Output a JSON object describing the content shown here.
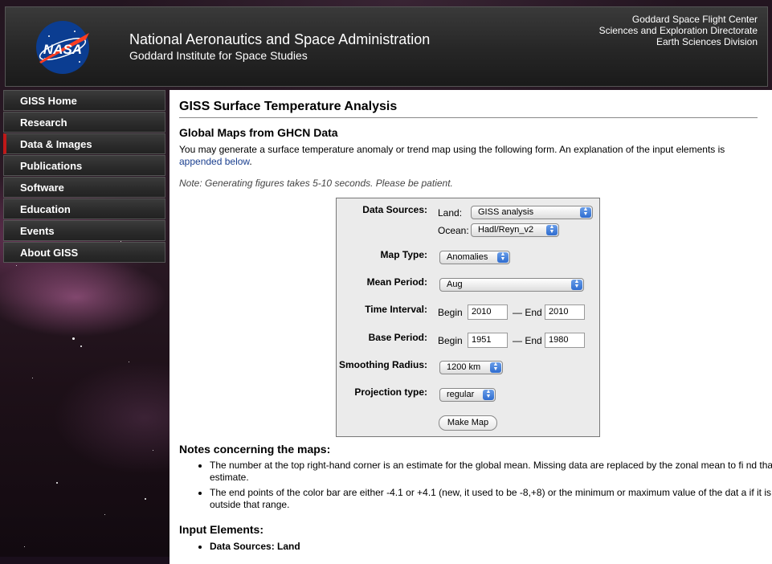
{
  "header": {
    "logo_text": "NASA",
    "title": "National Aeronautics and Space Administration",
    "subtitle": "Goddard Institute for Space Studies",
    "right_lines": [
      "Goddard Space Flight Center",
      "Sciences and Exploration Directorate",
      "Earth Sciences Division"
    ]
  },
  "nav": {
    "items": [
      {
        "label": "GISS Home"
      },
      {
        "label": "Research"
      },
      {
        "label": "Data & Images",
        "active": true
      },
      {
        "label": "Publications"
      },
      {
        "label": "Software"
      },
      {
        "label": "Education"
      },
      {
        "label": "Events"
      },
      {
        "label": "About GISS"
      }
    ]
  },
  "main": {
    "page_title": "GISS Surface Temperature Analysis",
    "section_title": "Global Maps from GHCN Data",
    "intro_text": "You may generate a surface temperature anomaly or trend map using the following form. An explanation of the input elements is",
    "intro_link": "appended below",
    "intro_end": ".",
    "note": "Note: Generating figures takes 5-10 seconds. Please be patient."
  },
  "form": {
    "data_sources_label": "Data Sources:",
    "land_label": "Land:",
    "land_value": "GISS analysis",
    "ocean_label": "Ocean:",
    "ocean_value": "Hadl/Reyn_v2",
    "map_type_label": "Map Type:",
    "map_type_value": "Anomalies",
    "mean_period_label": "Mean Period:",
    "mean_period_value": "Aug",
    "time_interval_label": "Time Interval:",
    "begin_label": "Begin",
    "end_label": "— End",
    "time_begin": "2010",
    "time_end": "2010",
    "base_period_label": "Base Period:",
    "base_begin": "1951",
    "base_end": "1980",
    "smoothing_label": "Smoothing Radius:",
    "smoothing_value": "1200 km",
    "projection_label": "Projection type:",
    "projection_value": "regular",
    "submit_label": "Make Map"
  },
  "notes": {
    "title": "Notes concerning the maps:",
    "items": [
      "The number at the top right-hand corner is an estimate for the global mean. Missing data are replaced by the zonal mean to fi nd that estimate.",
      "The end points of the color bar are either -4.1 or +4.1 (new, it used to be -8,+8) or the minimum or maximum value of the dat a if it is outside that range."
    ]
  },
  "input_elements": {
    "title": "Input Elements:",
    "items": [
      "Data Sources: Land"
    ]
  }
}
